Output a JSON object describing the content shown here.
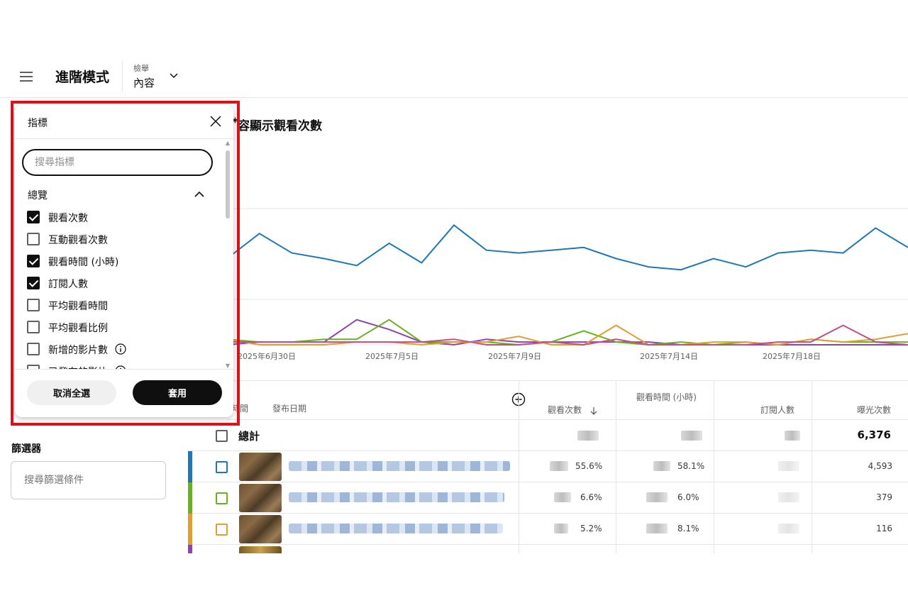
{
  "header": {
    "title": "進階模式",
    "selector_label": "檢舉",
    "selector_value": "內容"
  },
  "chart": {
    "title": "內容顯示觀看次數",
    "title_visible": "容顯示觀看次數"
  },
  "chart_data": {
    "type": "line",
    "x_tick_labels": [
      "2025年6月30日",
      "2025年7月5日",
      "2025年7月9日",
      "2025年7月14日",
      "2025年7月18日"
    ],
    "series": [
      {
        "color": "#1f77b4",
        "values": [
          62,
          80,
          66,
          62,
          57,
          73,
          59,
          86,
          68,
          66,
          68,
          70,
          62,
          56,
          54,
          62,
          56,
          66,
          68,
          66,
          84,
          70
        ]
      },
      {
        "color": "#8e44ad",
        "values": [
          0,
          2,
          2,
          2,
          18,
          11,
          2,
          0,
          4,
          2,
          2,
          2,
          2,
          2,
          0,
          0,
          0,
          0,
          0,
          0,
          0,
          0
        ]
      },
      {
        "color": "#6ab023",
        "values": [
          4,
          2,
          2,
          4,
          4,
          18,
          2,
          2,
          2,
          0,
          2,
          10,
          2,
          0,
          2,
          0,
          2,
          0,
          4,
          2,
          2,
          2
        ]
      },
      {
        "color": "#e0a030",
        "values": [
          4,
          0,
          0,
          0,
          2,
          2,
          0,
          2,
          2,
          6,
          0,
          0,
          14,
          0,
          0,
          2,
          2,
          0,
          4,
          2,
          4,
          8
        ]
      },
      {
        "color": "#c0508a",
        "values": [
          2,
          2,
          2,
          2,
          2,
          2,
          2,
          4,
          0,
          0,
          2,
          0,
          4,
          0,
          0,
          0,
          0,
          2,
          2,
          14,
          2,
          0
        ]
      }
    ],
    "ylim": [
      0,
      100
    ],
    "grid": true
  },
  "table": {
    "headers": {
      "time": "時間",
      "publish_date": "發布日期",
      "views": "觀看次數",
      "watch_time": "觀看時間 (小時)",
      "subscribers": "訂閱人數",
      "impressions": "曝光次數"
    },
    "total_label": "總計",
    "total_impressions": "6,376",
    "rows": [
      {
        "color": "#1f77b4",
        "views_pct": "55.6%",
        "watch_pct": "58.1%",
        "impressions": "4,593"
      },
      {
        "color": "#6ab023",
        "views_pct": "6.6%",
        "watch_pct": "6.0%",
        "impressions": "379"
      },
      {
        "color": "#e0a030",
        "views_pct": "5.2%",
        "watch_pct": "8.1%",
        "impressions": "116"
      },
      {
        "color": "#8e44ad"
      }
    ]
  },
  "filter": {
    "title": "篩選器",
    "placeholder": "搜尋篩選條件"
  },
  "metrics_popup": {
    "title": "指標",
    "search_placeholder": "搜尋指標",
    "section": "總覽",
    "items": [
      {
        "label": "觀看次數",
        "checked": true
      },
      {
        "label": "互動觀看次數",
        "checked": false
      },
      {
        "label": "觀看時間 (小時)",
        "checked": true
      },
      {
        "label": "訂閱人數",
        "checked": true
      },
      {
        "label": "平均觀看時間",
        "checked": false
      },
      {
        "label": "平均觀看比例",
        "checked": false
      },
      {
        "label": "新增的影片數",
        "checked": false,
        "info": true
      },
      {
        "label": "已發布的影片",
        "checked": false,
        "info": true
      }
    ],
    "clear_label": "取消全選",
    "apply_label": "套用"
  }
}
